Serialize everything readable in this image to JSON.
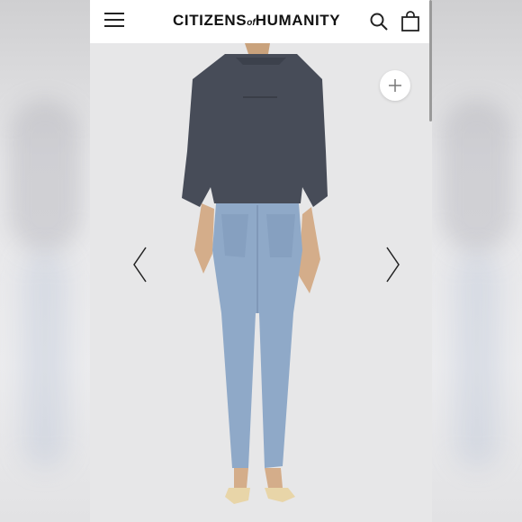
{
  "brand": {
    "part1": "CITIZENS",
    "part2": "of",
    "part3": "HUMANITY"
  },
  "icons": {
    "menu": "hamburger-menu-icon",
    "search": "search-icon",
    "bag": "shopping-bag-icon",
    "zoom": "plus-icon",
    "prev": "chevron-left-icon",
    "next": "chevron-right-icon"
  },
  "colors": {
    "header_bg": "#ffffff",
    "image_bg": "#e7e7e8",
    "shirt": "#474c58",
    "denim": "#8fa9c8"
  }
}
